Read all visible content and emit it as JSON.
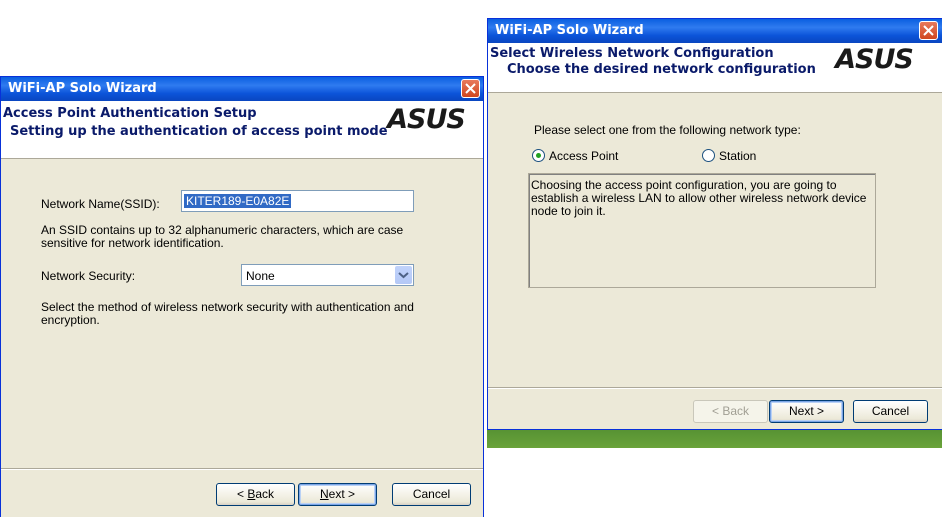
{
  "left_window": {
    "title": "WiFi-AP Solo Wizard",
    "header_title": "Access Point Authentication Setup",
    "header_subtitle": "Setting up the authentication of access point mode",
    "logo_text": "ASUS",
    "ssid_label": "Network Name(SSID):",
    "ssid_value": "KITER189-E0A82E",
    "ssid_hint": "An SSID contains up to 32 alphanumeric characters, which are case sensitive for network identification.",
    "security_label": "Network Security:",
    "security_value": "None",
    "security_hint": "Select the method of wireless network security with authentication and encryption.",
    "back_label_prefix": "< ",
    "back_label_accel": "B",
    "back_label_rest": "ack",
    "next_label_accel": "N",
    "next_label_rest": "ext >",
    "cancel_label": "Cancel"
  },
  "right_window": {
    "title": "WiFi-AP Solo Wizard",
    "header_title": "Select Wireless Network Configuration",
    "header_subtitle": "Choose the desired network configuration",
    "logo_text": "ASUS",
    "prompt": "Please select one from the following network type:",
    "options": [
      {
        "label": "Access Point",
        "selected": true
      },
      {
        "label": "Station",
        "selected": false
      }
    ],
    "description": "Choosing the access point configuration, you are going to establish a wireless LAN to allow other wireless network device node to join it.",
    "back_label": "< Back",
    "next_label": "Next >",
    "cancel_label": "Cancel"
  },
  "colors": {
    "titlebar": "#0a5fe0",
    "dialog_bg": "#ece9d8",
    "selection": "#316ac5",
    "close_button": "#d0461f"
  }
}
